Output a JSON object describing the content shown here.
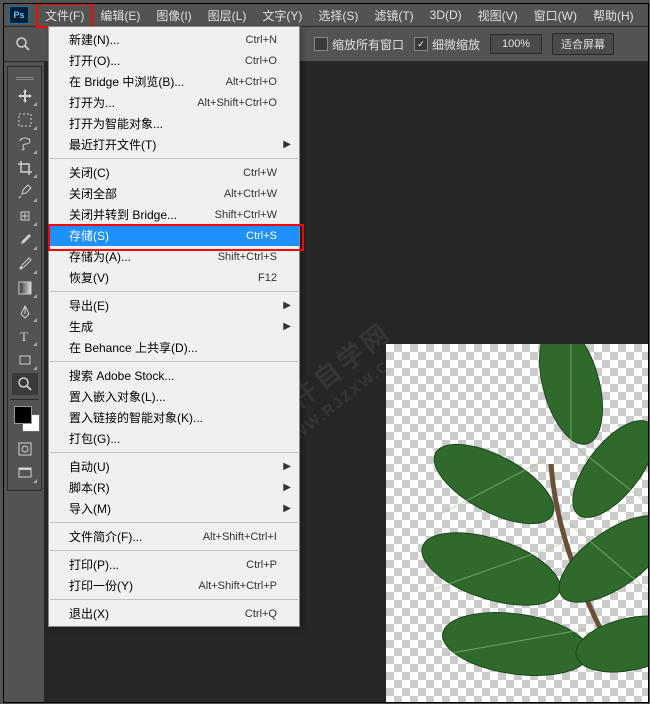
{
  "ps_logo": "Ps",
  "menu_bar": [
    "文件(F)",
    "编辑(E)",
    "图像(I)",
    "图层(L)",
    "文字(Y)",
    "选择(S)",
    "滤镜(T)",
    "3D(D)",
    "视图(V)",
    "窗口(W)",
    "帮助(H)"
  ],
  "active_menu_index": 0,
  "options": {
    "resize_windows": {
      "label": "缩放所有窗口",
      "checked": false
    },
    "scrubby_zoom": {
      "label": "细微缩放",
      "checked": true
    },
    "zoom_pct": "100%",
    "fit_screen": "适合屏幕"
  },
  "tools": [
    "move",
    "marquee",
    "lasso",
    "crop",
    "eyedropper",
    "spot-heal",
    "brush",
    "history-brush",
    "gradient",
    "pen",
    "type",
    "rectangle",
    "zoom"
  ],
  "dropdown": [
    {
      "label": "新建(N)...",
      "shortcut": "Ctrl+N"
    },
    {
      "label": "打开(O)...",
      "shortcut": "Ctrl+O"
    },
    {
      "label": "在 Bridge 中浏览(B)...",
      "shortcut": "Alt+Ctrl+O"
    },
    {
      "label": "打开为...",
      "shortcut": "Alt+Shift+Ctrl+O"
    },
    {
      "label": "打开为智能对象..."
    },
    {
      "label": "最近打开文件(T)",
      "submenu": true
    },
    {
      "sep": true
    },
    {
      "label": "关闭(C)",
      "shortcut": "Ctrl+W"
    },
    {
      "label": "关闭全部",
      "shortcut": "Alt+Ctrl+W"
    },
    {
      "label": "关闭并转到 Bridge...",
      "shortcut": "Shift+Ctrl+W"
    },
    {
      "label": "存储(S)",
      "shortcut": "Ctrl+S",
      "highlight": true
    },
    {
      "label": "存储为(A)...",
      "shortcut": "Shift+Ctrl+S"
    },
    {
      "label": "恢复(V)",
      "shortcut": "F12"
    },
    {
      "sep": true
    },
    {
      "label": "导出(E)",
      "submenu": true
    },
    {
      "label": "生成",
      "submenu": true
    },
    {
      "label": "在 Behance 上共享(D)..."
    },
    {
      "sep": true
    },
    {
      "label": "搜索 Adobe Stock..."
    },
    {
      "label": "置入嵌入对象(L)..."
    },
    {
      "label": "置入链接的智能对象(K)..."
    },
    {
      "label": "打包(G)..."
    },
    {
      "sep": true
    },
    {
      "label": "自动(U)",
      "submenu": true
    },
    {
      "label": "脚本(R)",
      "submenu": true
    },
    {
      "label": "导入(M)",
      "submenu": true
    },
    {
      "sep": true
    },
    {
      "label": "文件简介(F)...",
      "shortcut": "Alt+Shift+Ctrl+I"
    },
    {
      "sep": true
    },
    {
      "label": "打印(P)...",
      "shortcut": "Ctrl+P"
    },
    {
      "label": "打印一份(Y)",
      "shortcut": "Alt+Shift+Ctrl+P"
    },
    {
      "sep": true
    },
    {
      "label": "退出(X)",
      "shortcut": "Ctrl+Q"
    }
  ],
  "watermark": {
    "line1": "软件自学网",
    "line2": "WWW.RJZXW.COM"
  }
}
